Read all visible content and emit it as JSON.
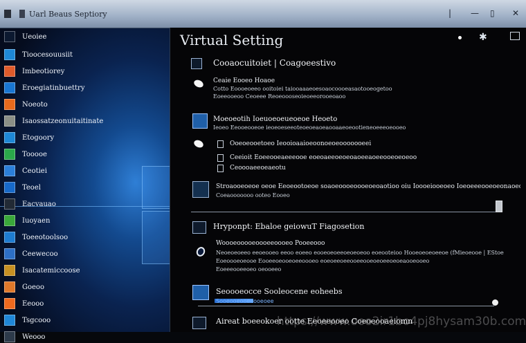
{
  "window": {
    "title": "Uarl Beaus Septiory"
  },
  "start_menu": {
    "header": "Ueoiee",
    "items": [
      {
        "label": "Tioocesouusiit",
        "color": "#1e88d6"
      },
      {
        "label": "Imbeotiorey",
        "color": "#e05b2b"
      },
      {
        "label": "Eroegiatinbuettry",
        "color": "#1976d2"
      },
      {
        "label": "Noeoto",
        "color": "#e86a1c"
      },
      {
        "label": "Isaossatzeonuitaitinate",
        "color": "#8b8f86"
      },
      {
        "label": "Etogoory",
        "color": "#1e88d6"
      },
      {
        "label": "Tooooe",
        "color": "#2aa84a"
      },
      {
        "label": "Ceotiei",
        "color": "#2b7fd9"
      },
      {
        "label": "Teoel",
        "color": "#1769c9"
      },
      {
        "label": "Eacvauao",
        "color": "#222a35"
      },
      {
        "label": "Iuoyaen",
        "color": "#3aa83a"
      },
      {
        "label": "Toeeotoolsoo",
        "color": "#1e7cd0"
      },
      {
        "label": "Ceewecoo",
        "color": "#2d6fc5"
      },
      {
        "label": "Isacatemiccoose",
        "color": "#c79022"
      },
      {
        "label": "Goeoo",
        "color": "#e0782a"
      },
      {
        "label": "Eeooo",
        "color": "#ef6a1e"
      },
      {
        "label": "Tsgcooo",
        "color": "#1f87d8"
      },
      {
        "label": "Weooo",
        "color": "#2d3a4a"
      }
    ]
  },
  "panel": {
    "title": "Virtual Setting",
    "sections": [
      {
        "heading": "Cooaocuitoiet | Coagoeestivo",
        "lines": [
          "Ceaie Eooeo Hoaoe",
          "Cotto Eoooeoeeo ooitoiei taiooaaaeoesoaocoooeasaotooeogetoo",
          "Eoeeooeoo  Ceoeee Reoeoooseoieoeeorooeoaoo"
        ]
      },
      {
        "heading": "Moeoeotih Ioeuoeoeueoeoe Heoeto",
        "lines": [
          "Ieoeo Eeooeooeoe ieoeoeseeoteoeoeaoeaooaaeoeootieneoeeeoeooeo",
          "Ooeoeooetoeo  Ieooioaaioeoonoeoeooooooeei",
          "Ceeioit  Eoeeooeaeeeooe eoeoaeeoeoeoaoeeaoeeooeoeoeoo",
          "Ceoooaeeoeaeotu"
        ]
      },
      {
        "heading": "Stroaooeoeoe oeoe Eeoeootoeoe soaoeoooeoooeoeoaotioo oiu Ioooeiooeoeo  Ioeoeeeooeoeonaoeoeo",
        "lines": [
          "Coeaooooooo ooteo Eooeo"
        ]
      },
      {
        "heading": "Hryponpt: Ebaloe geiowuT Fiagosetion",
        "lines": [
          "Woooeooooeoooeeoooeo Pooeeooo",
          "Neoeoeoeeo eeoeooeo eeoo eoeeo eooeoeoeeoeoeoeoo eoeooteioo Hooeoeoeoeeoe (fMieoeooe | EStoe",
          "Eoeoooeoeooe Eooeeoeooeoeeoooeo eoeoeeoeeooeeooeoeoeeoeoeaooeooeo",
          "Eoeeeooeeoeo oeooeeo"
        ]
      },
      {
        "heading": "Seoooeocce Sooleocene eoheebs",
        "lines": [
          "Sooeooeooeeooeoee"
        ]
      },
      {
        "heading": "Aireat boeeokoer ootte Eeoeeooeo Coeoeooaeiomn",
        "lines": []
      }
    ]
  },
  "watermark": "https://www.ooo2ir1bo4pj8hysam30b.com",
  "colors": {
    "accent": "#1f5fa8",
    "titlebar": "#9fb0c6",
    "panel_bg": "#050507"
  }
}
